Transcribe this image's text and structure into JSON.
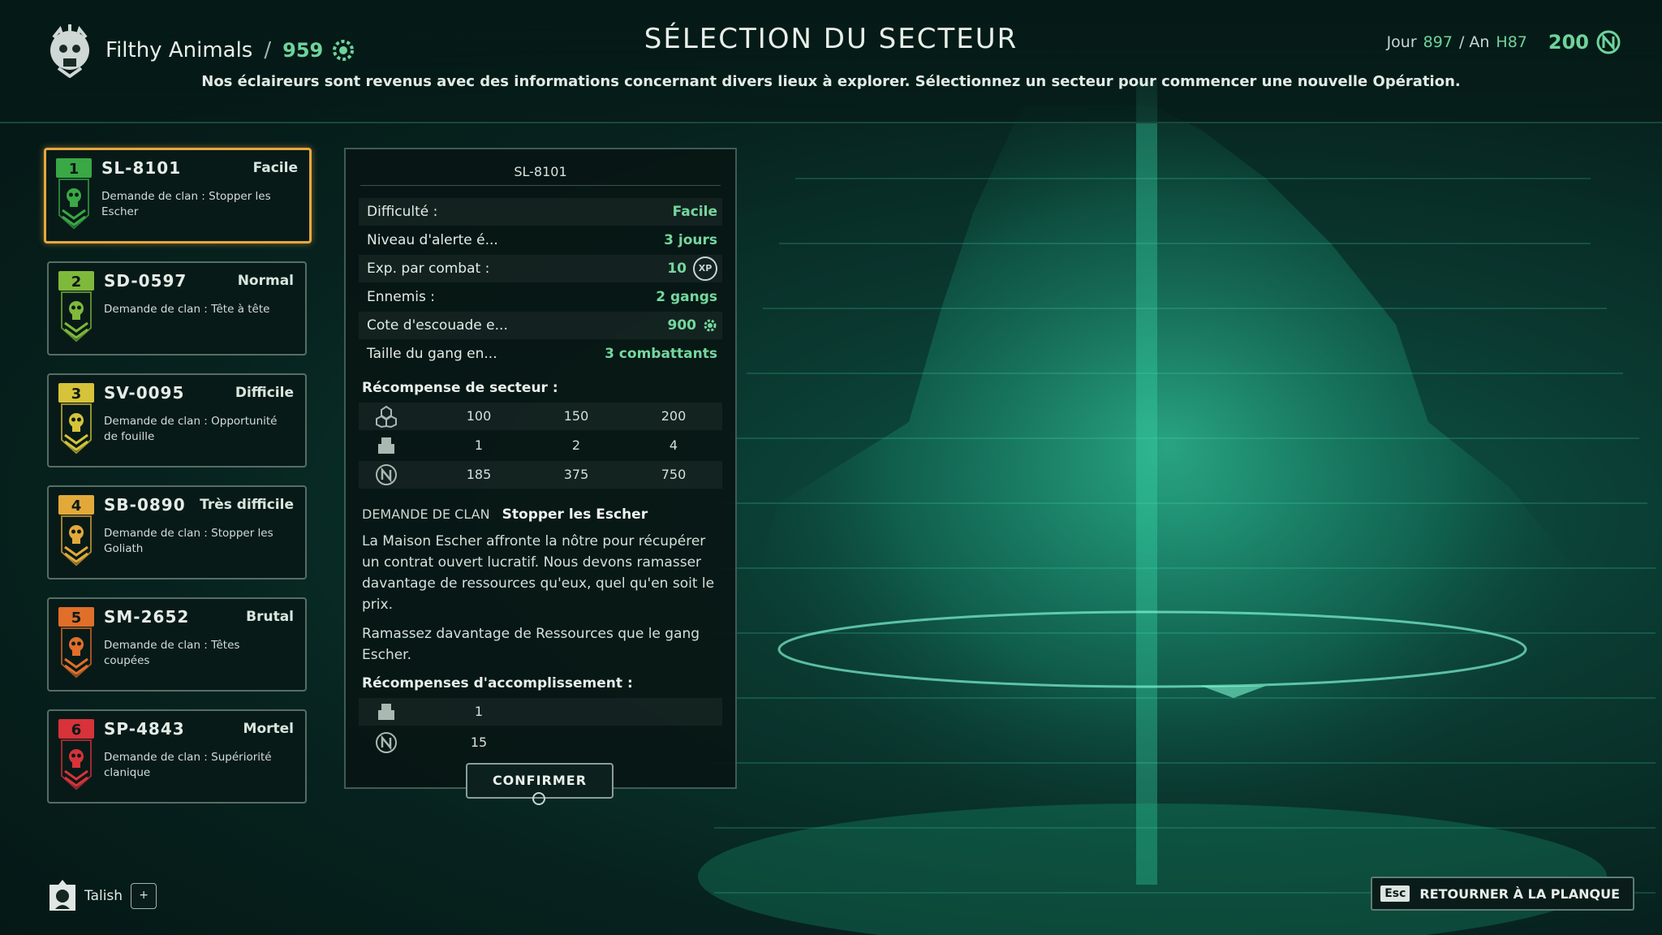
{
  "header": {
    "gang_name": "Filthy Animals",
    "separator": "/",
    "gang_rating": "959",
    "title": "SÉLECTION DU SECTEUR",
    "subtitle": "Nos éclaireurs sont revenus avec des informations concernant divers lieux à explorer. Sélectionnez un secteur pour commencer une nouvelle Opération.",
    "date_day_label": "Jour",
    "date_day": "897",
    "date_year_label": "/ An",
    "date_year": "H87",
    "credits": "200"
  },
  "sectors": [
    {
      "rank": "1",
      "code": "SL-8101",
      "difficulty": "Facile",
      "demand": "Demande de clan : Stopper les Escher",
      "color": "#3aa845"
    },
    {
      "rank": "2",
      "code": "SD-0597",
      "difficulty": "Normal",
      "demand": "Demande de clan : Tête à tête",
      "color": "#7fb93b"
    },
    {
      "rank": "3",
      "code": "SV-0095",
      "difficulty": "Difficile",
      "demand": "Demande de clan : Opportunité de fouille",
      "color": "#d6c33a"
    },
    {
      "rank": "4",
      "code": "SB-0890",
      "difficulty": "Très difficile",
      "demand": "Demande de clan : Stopper les Goliath",
      "color": "#e2a93a"
    },
    {
      "rank": "5",
      "code": "SM-2652",
      "difficulty": "Brutal",
      "demand": "Demande de clan : Têtes coupées",
      "color": "#e06f2a"
    },
    {
      "rank": "6",
      "code": "SP-4843",
      "difficulty": "Mortel",
      "demand": "Demande de clan : Supériorité clanique",
      "color": "#d8323a"
    }
  ],
  "details": {
    "heading": "SL-8101",
    "stats": [
      {
        "label": "Difficulté :",
        "value": "Facile"
      },
      {
        "label": "Niveau d'alerte é...",
        "value": "3 jours"
      },
      {
        "label": "Exp. par combat :",
        "value": "10"
      },
      {
        "label": "Ennemis :",
        "value": "2 gangs"
      },
      {
        "label": "Cote d'escouade e...",
        "value": "900"
      },
      {
        "label": "Taille du gang en...",
        "value": "3 combattants"
      }
    ],
    "xp_badge": "XP",
    "sector_reward_title": "Récompense de secteur :",
    "sector_rewards": [
      {
        "icon": "resources-icon",
        "values": [
          "100",
          "150",
          "200"
        ]
      },
      {
        "icon": "loot-crate-icon",
        "values": [
          "1",
          "2",
          "4"
        ]
      },
      {
        "icon": "credits-icon",
        "values": [
          "185",
          "375",
          "750"
        ]
      }
    ],
    "clan_demand_label": "DEMANDE DE CLAN",
    "clan_demand_name": "Stopper les Escher",
    "description": "La Maison Escher affronte la nôtre pour récupérer un contrat ouvert lucratif. Nous devons ramasser davantage de ressources qu'eux, quel qu'en soit le prix.",
    "objective": "Ramassez davantage de Ressources que le gang Escher.",
    "achievement_title": "Récompenses d'accomplissement :",
    "achievement_rewards": [
      {
        "icon": "loot-crate-icon",
        "value": "1"
      },
      {
        "icon": "credits-icon",
        "value": "15"
      }
    ],
    "confirm_label": "CONFIRMER"
  },
  "footer": {
    "player_name": "Talish",
    "plus_label": "+",
    "esc_key": "Esc",
    "back_label": "RETOURNER À LA PLANQUE"
  },
  "colors": {
    "accent_green": "#75d79e",
    "selected_border": "#e7a73e",
    "hologram": "#2fd4a0"
  }
}
